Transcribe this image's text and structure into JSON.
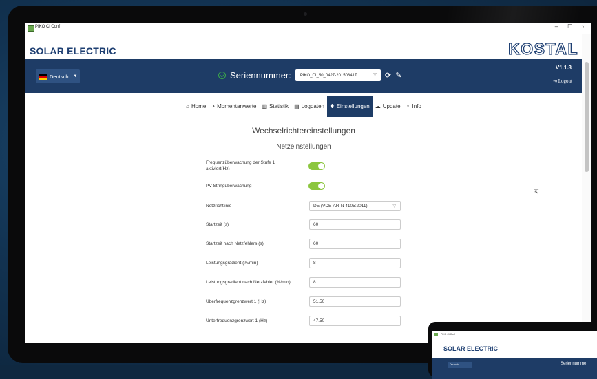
{
  "window": {
    "title": "PIKO Ci Conf",
    "minimize": "–",
    "maximize": "☐",
    "close": "›"
  },
  "brand": {
    "name": "SOLAR ELECTRIC",
    "logo": "KOSTAL"
  },
  "header": {
    "language": "Deutsch",
    "serial_label": "Seriennummer:",
    "serial_value": "PIKO_CI_50_0427-20150841T",
    "version": "V1.1.3",
    "logout": "Logout"
  },
  "menu": {
    "home": "Home",
    "momentanwerte": "Momentanwerte",
    "statistik": "Statistik",
    "logdaten": "Logdaten",
    "einstellungen": "Einstellungen",
    "update": "Update",
    "info": "Info",
    "active": "einstellungen"
  },
  "page": {
    "title": "Wechselrichtereinstellungen",
    "section": "Netzeinstellungen"
  },
  "settings": [
    {
      "label": "Frequenzüberwachung der Stufe 1 aktiviert(Hz)",
      "type": "toggle",
      "value": "on"
    },
    {
      "label": "PV-Stringüberwachung",
      "type": "toggle",
      "value": "on"
    },
    {
      "label": "Netzrichtlinie",
      "type": "select",
      "value": "DE (VDE-AR-N 4105:2011)"
    },
    {
      "label": "Startzeit (s)",
      "type": "text",
      "value": "60"
    },
    {
      "label": "Startzeit nach Netzfehlers (s)",
      "type": "text",
      "value": "60"
    },
    {
      "label": "Leistungsgradient (%/min)",
      "type": "text",
      "value": "8"
    },
    {
      "label": "Leistungsgradient nach Netzfehler (%/min)",
      "type": "text",
      "value": "8"
    },
    {
      "label": "Überfrequenzgrenzwert 1 (Hz)",
      "type": "text",
      "value": "51.50"
    },
    {
      "label": "Unterfrequenzgrenzwert 1 (Hz)",
      "type": "text",
      "value": "47.50"
    }
  ],
  "mini_device": {
    "title": "PIKO Ci Conf",
    "brand": "SOLAR ELECTRIC",
    "language": "Deutsch",
    "serial_label": "Seriennumme"
  },
  "colors": {
    "navy": "#1e3c66",
    "toggle_on": "#8cc63f",
    "ok_green": "#3aa84a"
  }
}
